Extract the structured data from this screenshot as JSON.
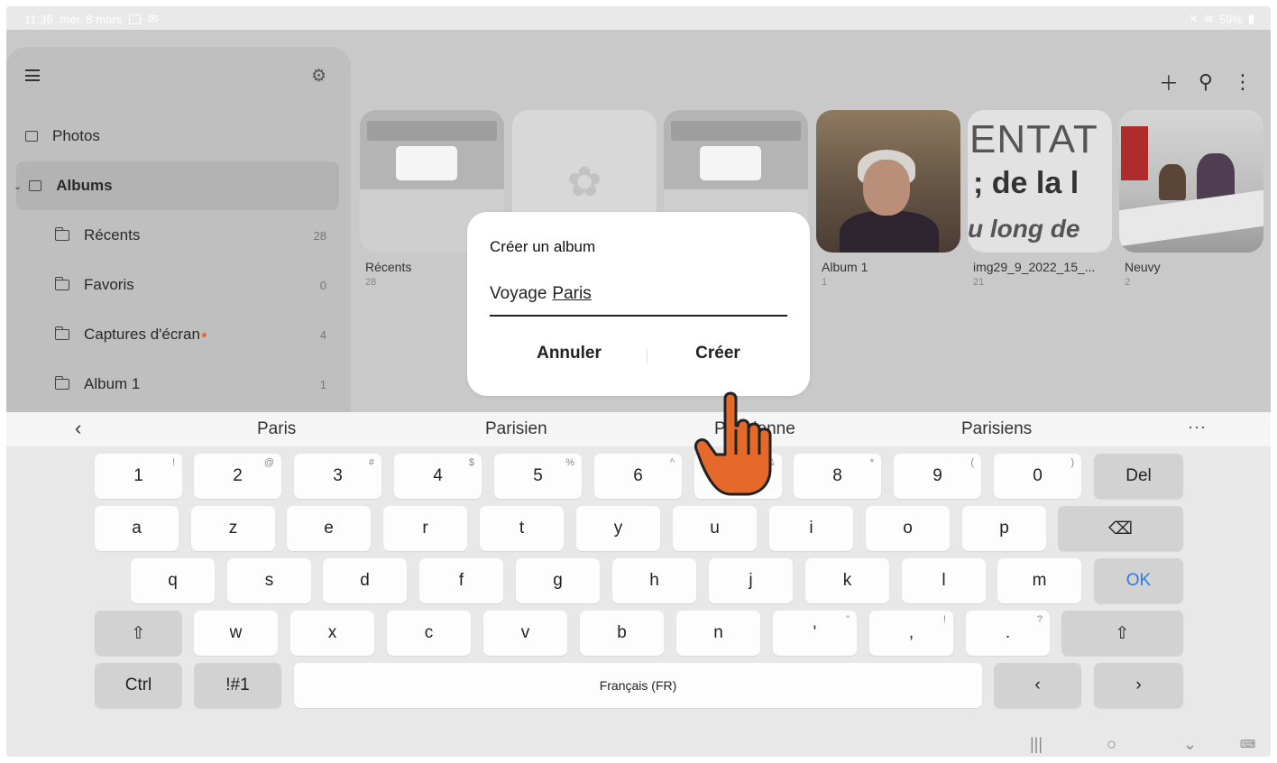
{
  "status_bar": {
    "time": "11:36",
    "date": "mer. 8 mars",
    "battery": "59%"
  },
  "sidebar": {
    "items": [
      {
        "label": "Photos",
        "count": ""
      },
      {
        "label": "Albums",
        "count": ""
      },
      {
        "label": "Récents",
        "count": "28"
      },
      {
        "label": "Favoris",
        "count": "0"
      },
      {
        "label": "Captures d'écran",
        "count": "4"
      },
      {
        "label": "Album 1",
        "count": "1"
      }
    ]
  },
  "albums": [
    {
      "name": "Récents",
      "count": "28"
    },
    {
      "name": "",
      "count": ""
    },
    {
      "name": "",
      "count": ""
    },
    {
      "name": "Album 1",
      "count": "1"
    },
    {
      "name": "img29_9_2022_15_...",
      "count": "21"
    },
    {
      "name": "Neuvy",
      "count": "2"
    }
  ],
  "thumb_text": {
    "line1": "ENTAT",
    "line2": "; de la l",
    "line3": "u long de"
  },
  "dialog": {
    "title": "Créer un album",
    "input_prefix": "Voyage",
    "input_composing": "Paris",
    "cancel_label": "Annuler",
    "create_label": "Créer"
  },
  "suggestions": [
    "Paris",
    "Parisien",
    "Parisienne",
    "Parisiens"
  ],
  "keyboard": {
    "row_numbers": [
      {
        "k": "1",
        "s": "!"
      },
      {
        "k": "2",
        "s": "@"
      },
      {
        "k": "3",
        "s": "#"
      },
      {
        "k": "4",
        "s": "$"
      },
      {
        "k": "5",
        "s": "%"
      },
      {
        "k": "6",
        "s": "^"
      },
      {
        "k": "7",
        "s": "&"
      },
      {
        "k": "8",
        "s": "*"
      },
      {
        "k": "9",
        "s": "("
      },
      {
        "k": "0",
        "s": ")"
      }
    ],
    "del": "Del",
    "row_a": [
      "a",
      "z",
      "e",
      "r",
      "t",
      "y",
      "u",
      "i",
      "o",
      "p"
    ],
    "row_q": [
      "q",
      "s",
      "d",
      "f",
      "g",
      "h",
      "j",
      "k",
      "l",
      "m"
    ],
    "ok": "OK",
    "row_w": [
      "w",
      "x",
      "c",
      "v",
      "b",
      "n"
    ],
    "punct": [
      {
        "k": "'",
        "s": "\""
      },
      {
        "k": ",",
        "s": "!"
      },
      {
        "k": ".",
        "s": "?"
      }
    ],
    "ctrl": "Ctrl",
    "symbols": "!#1",
    "space": "Français (FR)"
  },
  "colors": {
    "accent": "#2b7be3",
    "hand": "#e4692a",
    "dot": "#e4692a"
  }
}
